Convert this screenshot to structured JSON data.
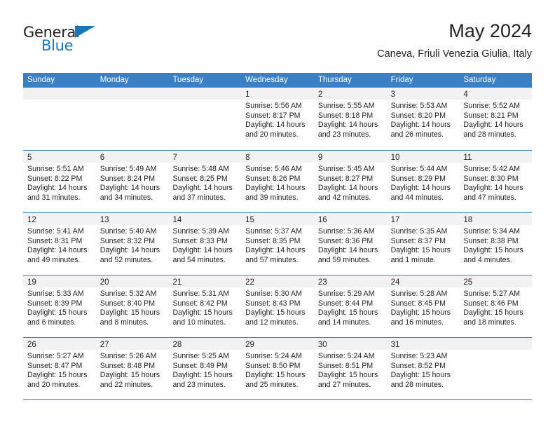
{
  "brand": {
    "name_part1": "General",
    "name_part2": "Blue",
    "accent_color": "#1b75bb"
  },
  "header": {
    "title": "May 2024",
    "subtitle": "Caneva, Friuli Venezia Giulia, Italy"
  },
  "theme": {
    "header_blue": "#3b7fc4",
    "day_band_gray": "#f2f2f2",
    "text_color": "#231f20"
  },
  "weekdays": [
    "Sunday",
    "Monday",
    "Tuesday",
    "Wednesday",
    "Thursday",
    "Friday",
    "Saturday"
  ],
  "weeks": [
    [
      {
        "day": "",
        "sunrise": "",
        "sunset": "",
        "daylight_line1": "",
        "daylight_line2": ""
      },
      {
        "day": "",
        "sunrise": "",
        "sunset": "",
        "daylight_line1": "",
        "daylight_line2": ""
      },
      {
        "day": "",
        "sunrise": "",
        "sunset": "",
        "daylight_line1": "",
        "daylight_line2": ""
      },
      {
        "day": "1",
        "sunrise": "Sunrise: 5:56 AM",
        "sunset": "Sunset: 8:17 PM",
        "daylight_line1": "Daylight: 14 hours",
        "daylight_line2": "and 20 minutes."
      },
      {
        "day": "2",
        "sunrise": "Sunrise: 5:55 AM",
        "sunset": "Sunset: 8:18 PM",
        "daylight_line1": "Daylight: 14 hours",
        "daylight_line2": "and 23 minutes."
      },
      {
        "day": "3",
        "sunrise": "Sunrise: 5:53 AM",
        "sunset": "Sunset: 8:20 PM",
        "daylight_line1": "Daylight: 14 hours",
        "daylight_line2": "and 26 minutes."
      },
      {
        "day": "4",
        "sunrise": "Sunrise: 5:52 AM",
        "sunset": "Sunset: 8:21 PM",
        "daylight_line1": "Daylight: 14 hours",
        "daylight_line2": "and 28 minutes."
      }
    ],
    [
      {
        "day": "5",
        "sunrise": "Sunrise: 5:51 AM",
        "sunset": "Sunset: 8:22 PM",
        "daylight_line1": "Daylight: 14 hours",
        "daylight_line2": "and 31 minutes."
      },
      {
        "day": "6",
        "sunrise": "Sunrise: 5:49 AM",
        "sunset": "Sunset: 8:24 PM",
        "daylight_line1": "Daylight: 14 hours",
        "daylight_line2": "and 34 minutes."
      },
      {
        "day": "7",
        "sunrise": "Sunrise: 5:48 AM",
        "sunset": "Sunset: 8:25 PM",
        "daylight_line1": "Daylight: 14 hours",
        "daylight_line2": "and 37 minutes."
      },
      {
        "day": "8",
        "sunrise": "Sunrise: 5:46 AM",
        "sunset": "Sunset: 8:26 PM",
        "daylight_line1": "Daylight: 14 hours",
        "daylight_line2": "and 39 minutes."
      },
      {
        "day": "9",
        "sunrise": "Sunrise: 5:45 AM",
        "sunset": "Sunset: 8:27 PM",
        "daylight_line1": "Daylight: 14 hours",
        "daylight_line2": "and 42 minutes."
      },
      {
        "day": "10",
        "sunrise": "Sunrise: 5:44 AM",
        "sunset": "Sunset: 8:29 PM",
        "daylight_line1": "Daylight: 14 hours",
        "daylight_line2": "and 44 minutes."
      },
      {
        "day": "11",
        "sunrise": "Sunrise: 5:42 AM",
        "sunset": "Sunset: 8:30 PM",
        "daylight_line1": "Daylight: 14 hours",
        "daylight_line2": "and 47 minutes."
      }
    ],
    [
      {
        "day": "12",
        "sunrise": "Sunrise: 5:41 AM",
        "sunset": "Sunset: 8:31 PM",
        "daylight_line1": "Daylight: 14 hours",
        "daylight_line2": "and 49 minutes."
      },
      {
        "day": "13",
        "sunrise": "Sunrise: 5:40 AM",
        "sunset": "Sunset: 8:32 PM",
        "daylight_line1": "Daylight: 14 hours",
        "daylight_line2": "and 52 minutes."
      },
      {
        "day": "14",
        "sunrise": "Sunrise: 5:39 AM",
        "sunset": "Sunset: 8:33 PM",
        "daylight_line1": "Daylight: 14 hours",
        "daylight_line2": "and 54 minutes."
      },
      {
        "day": "15",
        "sunrise": "Sunrise: 5:37 AM",
        "sunset": "Sunset: 8:35 PM",
        "daylight_line1": "Daylight: 14 hours",
        "daylight_line2": "and 57 minutes."
      },
      {
        "day": "16",
        "sunrise": "Sunrise: 5:36 AM",
        "sunset": "Sunset: 8:36 PM",
        "daylight_line1": "Daylight: 14 hours",
        "daylight_line2": "and 59 minutes."
      },
      {
        "day": "17",
        "sunrise": "Sunrise: 5:35 AM",
        "sunset": "Sunset: 8:37 PM",
        "daylight_line1": "Daylight: 15 hours",
        "daylight_line2": "and 1 minute."
      },
      {
        "day": "18",
        "sunrise": "Sunrise: 5:34 AM",
        "sunset": "Sunset: 8:38 PM",
        "daylight_line1": "Daylight: 15 hours",
        "daylight_line2": "and 4 minutes."
      }
    ],
    [
      {
        "day": "19",
        "sunrise": "Sunrise: 5:33 AM",
        "sunset": "Sunset: 8:39 PM",
        "daylight_line1": "Daylight: 15 hours",
        "daylight_line2": "and 6 minutes."
      },
      {
        "day": "20",
        "sunrise": "Sunrise: 5:32 AM",
        "sunset": "Sunset: 8:40 PM",
        "daylight_line1": "Daylight: 15 hours",
        "daylight_line2": "and 8 minutes."
      },
      {
        "day": "21",
        "sunrise": "Sunrise: 5:31 AM",
        "sunset": "Sunset: 8:42 PM",
        "daylight_line1": "Daylight: 15 hours",
        "daylight_line2": "and 10 minutes."
      },
      {
        "day": "22",
        "sunrise": "Sunrise: 5:30 AM",
        "sunset": "Sunset: 8:43 PM",
        "daylight_line1": "Daylight: 15 hours",
        "daylight_line2": "and 12 minutes."
      },
      {
        "day": "23",
        "sunrise": "Sunrise: 5:29 AM",
        "sunset": "Sunset: 8:44 PM",
        "daylight_line1": "Daylight: 15 hours",
        "daylight_line2": "and 14 minutes."
      },
      {
        "day": "24",
        "sunrise": "Sunrise: 5:28 AM",
        "sunset": "Sunset: 8:45 PM",
        "daylight_line1": "Daylight: 15 hours",
        "daylight_line2": "and 16 minutes."
      },
      {
        "day": "25",
        "sunrise": "Sunrise: 5:27 AM",
        "sunset": "Sunset: 8:46 PM",
        "daylight_line1": "Daylight: 15 hours",
        "daylight_line2": "and 18 minutes."
      }
    ],
    [
      {
        "day": "26",
        "sunrise": "Sunrise: 5:27 AM",
        "sunset": "Sunset: 8:47 PM",
        "daylight_line1": "Daylight: 15 hours",
        "daylight_line2": "and 20 minutes."
      },
      {
        "day": "27",
        "sunrise": "Sunrise: 5:26 AM",
        "sunset": "Sunset: 8:48 PM",
        "daylight_line1": "Daylight: 15 hours",
        "daylight_line2": "and 22 minutes."
      },
      {
        "day": "28",
        "sunrise": "Sunrise: 5:25 AM",
        "sunset": "Sunset: 8:49 PM",
        "daylight_line1": "Daylight: 15 hours",
        "daylight_line2": "and 23 minutes."
      },
      {
        "day": "29",
        "sunrise": "Sunrise: 5:24 AM",
        "sunset": "Sunset: 8:50 PM",
        "daylight_line1": "Daylight: 15 hours",
        "daylight_line2": "and 25 minutes."
      },
      {
        "day": "30",
        "sunrise": "Sunrise: 5:24 AM",
        "sunset": "Sunset: 8:51 PM",
        "daylight_line1": "Daylight: 15 hours",
        "daylight_line2": "and 27 minutes."
      },
      {
        "day": "31",
        "sunrise": "Sunrise: 5:23 AM",
        "sunset": "Sunset: 8:52 PM",
        "daylight_line1": "Daylight: 15 hours",
        "daylight_line2": "and 28 minutes."
      },
      {
        "day": "",
        "sunrise": "",
        "sunset": "",
        "daylight_line1": "",
        "daylight_line2": ""
      }
    ]
  ]
}
